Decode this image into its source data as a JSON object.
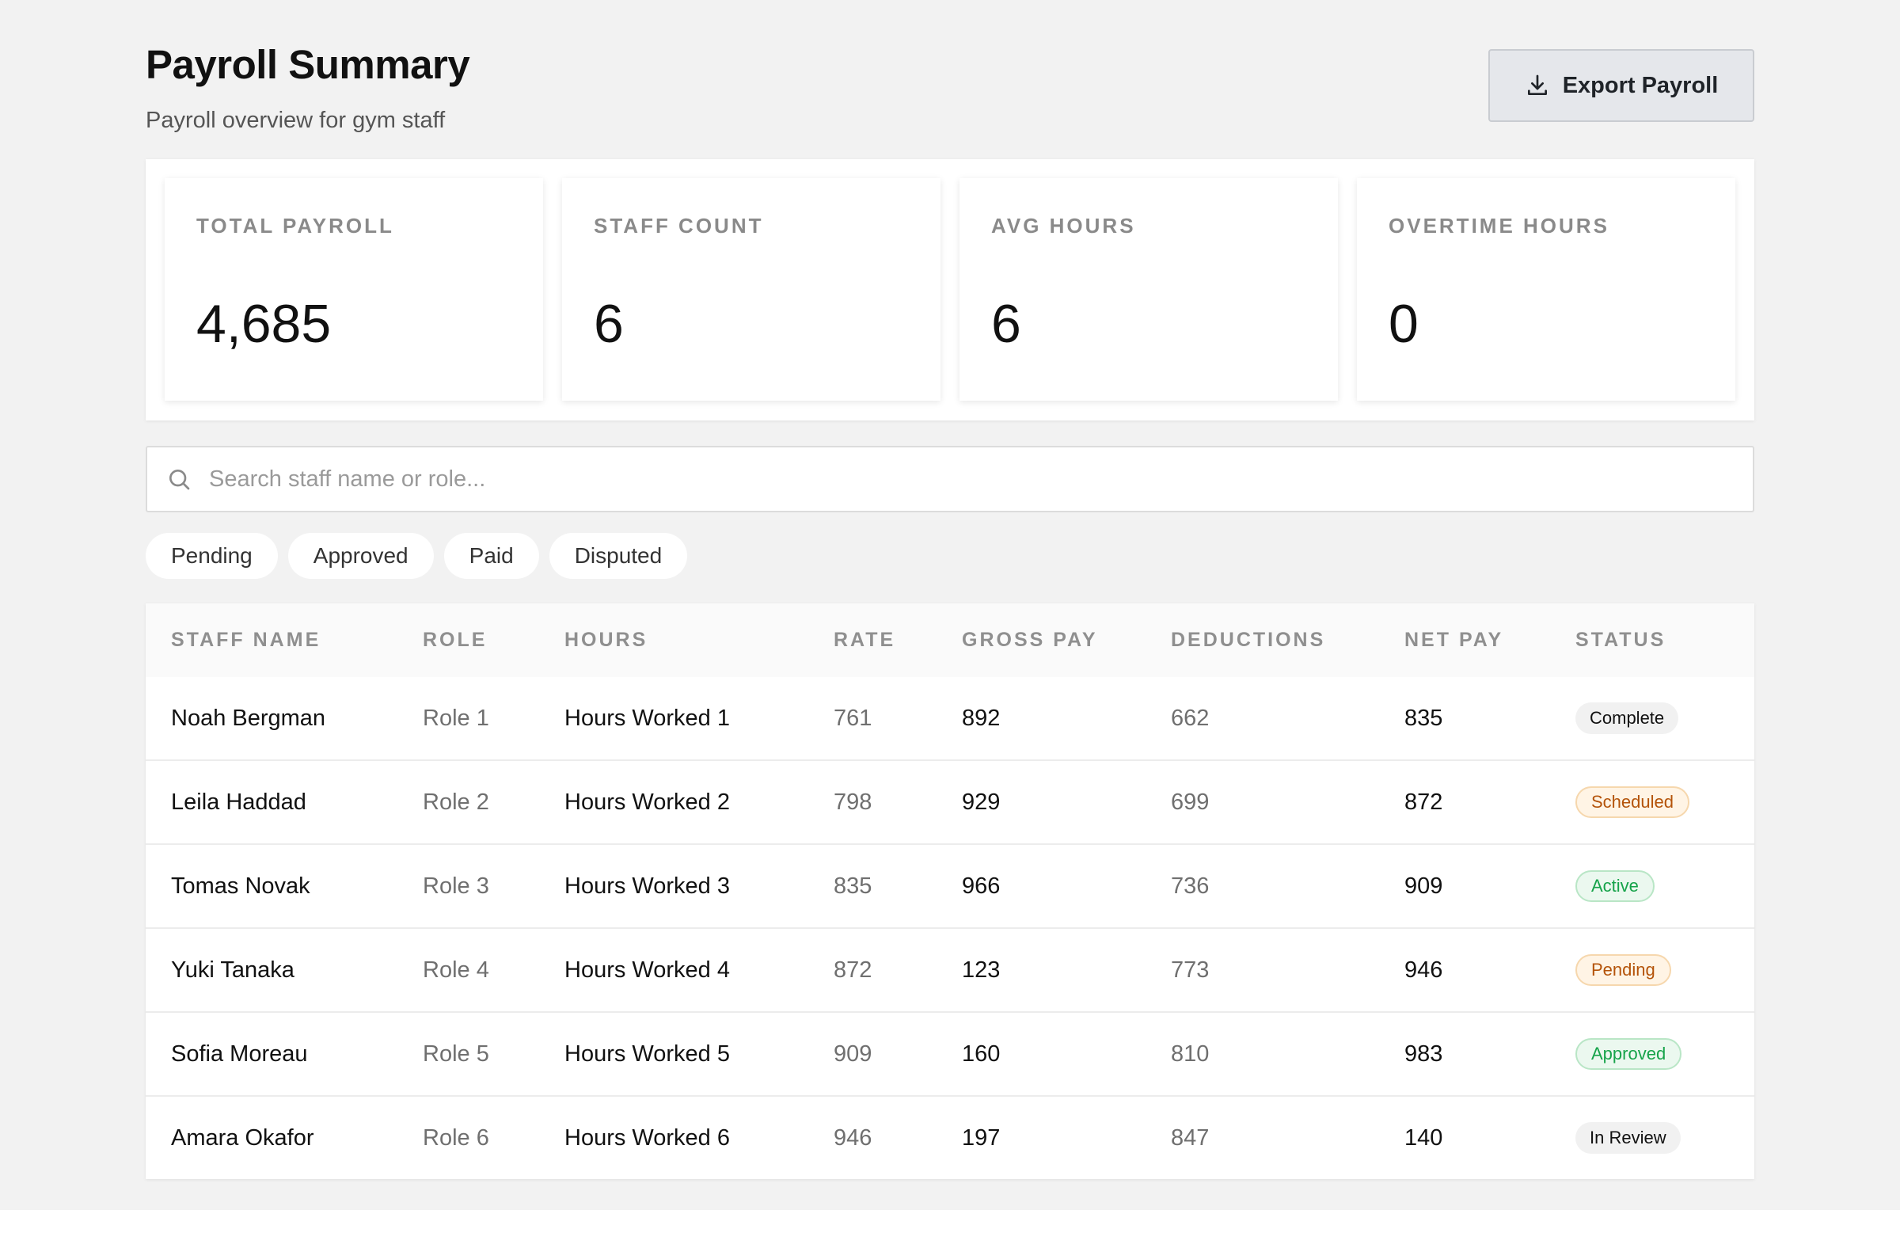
{
  "header": {
    "title": "Payroll Summary",
    "subtitle": "Payroll overview for gym staff",
    "export_label": "Export Payroll"
  },
  "stats": [
    {
      "label": "TOTAL PAYROLL",
      "value": "4,685"
    },
    {
      "label": "STAFF COUNT",
      "value": "6"
    },
    {
      "label": "AVG HOURS",
      "value": "6"
    },
    {
      "label": "OVERTIME HOURS",
      "value": "0"
    }
  ],
  "search": {
    "placeholder": "Search staff name or role...",
    "value": ""
  },
  "filters": [
    "Pending",
    "Approved",
    "Paid",
    "Disputed"
  ],
  "table": {
    "columns": [
      "STAFF NAME",
      "ROLE",
      "HOURS",
      "RATE",
      "GROSS PAY",
      "DEDUCTIONS",
      "NET PAY",
      "STATUS"
    ],
    "rows": [
      {
        "name": "Noah Bergman",
        "role": "Role 1",
        "hours": "Hours Worked 1",
        "rate": "761",
        "gross": "892",
        "deductions": "662",
        "net": "835",
        "status": "Complete",
        "status_kind": "complete"
      },
      {
        "name": "Leila Haddad",
        "role": "Role 2",
        "hours": "Hours Worked 2",
        "rate": "798",
        "gross": "929",
        "deductions": "699",
        "net": "872",
        "status": "Scheduled",
        "status_kind": "scheduled"
      },
      {
        "name": "Tomas Novak",
        "role": "Role 3",
        "hours": "Hours Worked 3",
        "rate": "835",
        "gross": "966",
        "deductions": "736",
        "net": "909",
        "status": "Active",
        "status_kind": "active"
      },
      {
        "name": "Yuki Tanaka",
        "role": "Role 4",
        "hours": "Hours Worked 4",
        "rate": "872",
        "gross": "123",
        "deductions": "773",
        "net": "946",
        "status": "Pending",
        "status_kind": "pending"
      },
      {
        "name": "Sofia Moreau",
        "role": "Role 5",
        "hours": "Hours Worked 5",
        "rate": "909",
        "gross": "160",
        "deductions": "810",
        "net": "983",
        "status": "Approved",
        "status_kind": "approved"
      },
      {
        "name": "Amara Okafor",
        "role": "Role 6",
        "hours": "Hours Worked 6",
        "rate": "946",
        "gross": "197",
        "deductions": "847",
        "net": "140",
        "status": "In Review",
        "status_kind": "review"
      }
    ]
  },
  "icons": {
    "export": "download-icon",
    "search": "search-icon"
  },
  "colors": {
    "background": "#f2f2f2",
    "button_bg": "#e5e7eb",
    "warning": "#b45309",
    "success": "#16a34a"
  }
}
